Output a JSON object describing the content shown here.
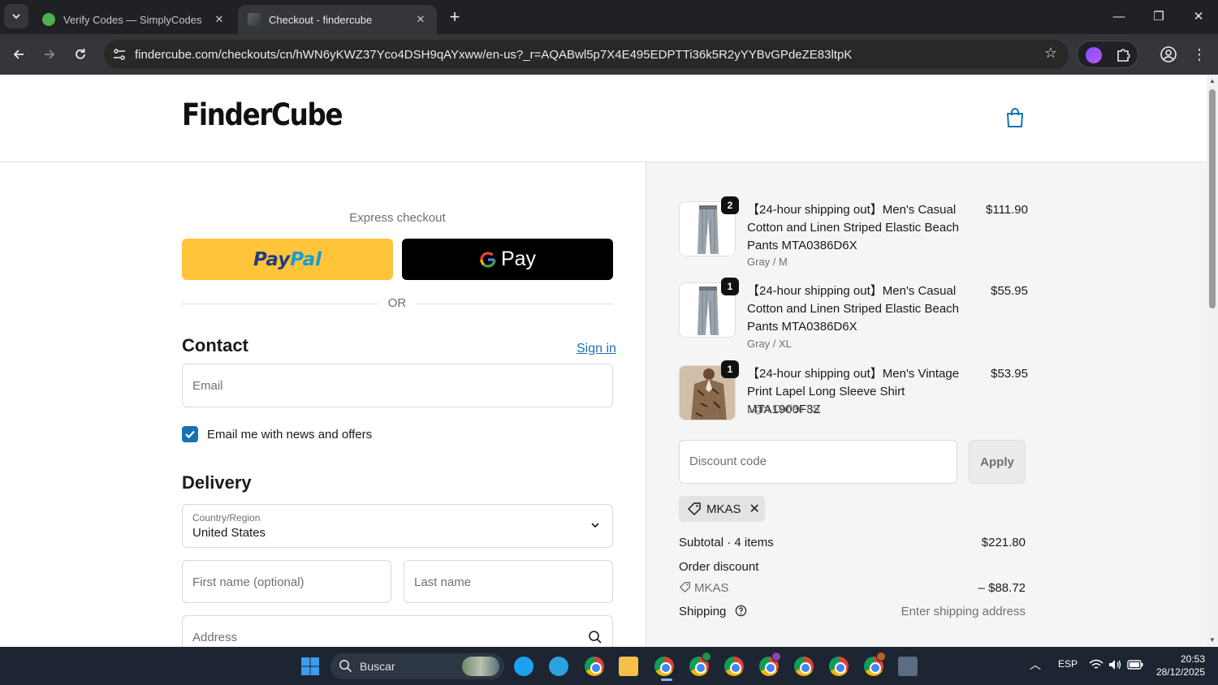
{
  "browser": {
    "tabs": [
      {
        "title": "Verify Codes — SimplyCodes",
        "favicon": "simplycodes-icon"
      },
      {
        "title": "Checkout - findercube",
        "favicon": "findercube-icon"
      }
    ],
    "url": "findercube.com/checkouts/cn/hWN6yKWZ37Yco4DSH9qAYxww/en-us?_r=AQABwl5p7X4E495EDPTTi36k5R2yYYBvGPdeZE83ltpK"
  },
  "store": {
    "logo": "FinderCube"
  },
  "checkout": {
    "express_label": "Express checkout",
    "paypal_a": "Pay",
    "paypal_b": "Pal",
    "gpay_label": "Pay",
    "or": "OR",
    "contact_heading": "Contact",
    "sign_in": "Sign in",
    "email_placeholder": "Email",
    "news_label": "Email me with news and offers",
    "news_checked": true,
    "delivery_heading": "Delivery",
    "country_label": "Country/Region",
    "country_value": "United States",
    "first_name_placeholder": "First name (optional)",
    "last_name_placeholder": "Last name",
    "address_placeholder": "Address"
  },
  "summary": {
    "items": [
      {
        "qty": "2",
        "title": "【24-hour shipping out】Men's Casual Cotton and Linen Striped Elastic Beach Pants MTA0386D6X",
        "variant": "Gray / M",
        "price": "$111.90"
      },
      {
        "qty": "1",
        "title": "【24-hour shipping out】Men's Casual Cotton and Linen Striped Elastic Beach Pants MTA0386D6X",
        "variant": "Gray / XL",
        "price": "$55.95"
      },
      {
        "qty": "1",
        "title": "【24-hour shipping out】Men's Vintage Print Lapel Long Sleeve Shirt MTA1900F3Z",
        "variant": "Light Coffee / S",
        "price": "$53.95"
      }
    ],
    "discount_placeholder": "Discount code",
    "apply_label": "Apply",
    "applied_code": "MKAS",
    "subtotal_label": "Subtotal · 4 items",
    "subtotal_value": "$221.80",
    "order_discount_label": "Order discount",
    "discount_code": "MKAS",
    "discount_value": "– $88.72",
    "shipping_label": "Shipping",
    "shipping_value": "Enter shipping address"
  },
  "taskbar": {
    "search_label": "Buscar",
    "language": "ESP",
    "time": "20:53",
    "date": "28/12/2025"
  },
  "colors": {
    "paypal_yellow": "#ffc439",
    "link_blue": "#1f6fb5",
    "checkbox_blue": "#1773b0"
  }
}
